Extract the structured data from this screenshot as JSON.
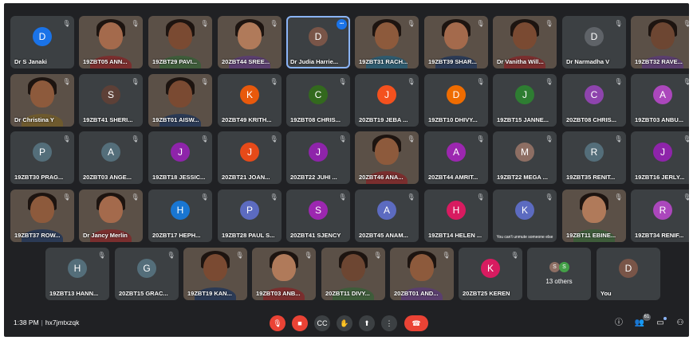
{
  "colors": {
    "background": "#202124",
    "tile": "#3c4043",
    "active_border": "#8ab4f8",
    "danger": "#ea4335"
  },
  "rows": [
    [
      {
        "name": "Dr S Janaki",
        "initial": "D",
        "color": "#1a73e8",
        "video": false
      },
      {
        "name": "19ZBT05 ANN...",
        "video": true
      },
      {
        "name": "19ZBT29 PAVI...",
        "video": true
      },
      {
        "name": "20ZBT44 SREE...",
        "video": true
      },
      {
        "name": "Dr Judia Harrie...",
        "initial": "D",
        "color": "#795548",
        "video": false,
        "active": true,
        "more": true
      },
      {
        "name": "19ZBT31 RACH...",
        "video": true
      },
      {
        "name": "19ZBT39 SHAR...",
        "video": true
      },
      {
        "name": "Dr Vanitha Will...",
        "video": true
      },
      {
        "name": "Dr Narmadha V",
        "initial": "D",
        "color": "#5f6368",
        "video": false
      },
      {
        "name": "19ZBT32 RAVE...",
        "video": true
      }
    ],
    [
      {
        "name": "Dr Christina Y",
        "video": true
      },
      {
        "name": "19ZBT41 SHERI...",
        "initial": "S",
        "color": "#5d4037",
        "video": false
      },
      {
        "name": "19ZBT01 AISW...",
        "video": true
      },
      {
        "name": "20ZBT49 KRITH...",
        "initial": "K",
        "color": "#e8590c",
        "video": false
      },
      {
        "name": "19ZBT08 CHRIS...",
        "initial": "C",
        "color": "#33691e",
        "video": false
      },
      {
        "name": "20ZBT19 JEBA ...",
        "initial": "J",
        "color": "#f4511e",
        "video": false
      },
      {
        "name": "19ZBT10 DHIVY...",
        "initial": "D",
        "color": "#ef6c00",
        "video": false
      },
      {
        "name": "19ZBT15 JANNE...",
        "initial": "J",
        "color": "#2e7d32",
        "video": false
      },
      {
        "name": "20ZBT08 CHRIS...",
        "initial": "C",
        "color": "#8e44ad",
        "video": false
      },
      {
        "name": "19ZBT03 ANBU...",
        "initial": "A",
        "color": "#ab47bc",
        "video": false
      }
    ],
    [
      {
        "name": "19ZBT30 PRAG...",
        "initial": "P",
        "color": "#546e7a",
        "video": false
      },
      {
        "name": "20ZBT03 ANGE...",
        "initial": "A",
        "color": "#546e7a",
        "video": false
      },
      {
        "name": "19ZBT18 JESSIC...",
        "initial": "J",
        "color": "#8e24aa",
        "video": false
      },
      {
        "name": "20ZBT21 JOAN...",
        "initial": "J",
        "color": "#e64a19",
        "video": false
      },
      {
        "name": "20ZBT22 JUHI ...",
        "initial": "J",
        "color": "#8e24aa",
        "video": false
      },
      {
        "name": "20ZBT46 ANA...",
        "video": true
      },
      {
        "name": "20ZBT44 AMRIT...",
        "initial": "A",
        "color": "#9c27b0",
        "video": false
      },
      {
        "name": "19ZBT22 MEGA ...",
        "initial": "M",
        "color": "#8d6e63",
        "video": false
      },
      {
        "name": "19ZBT35 RENIT...",
        "initial": "R",
        "color": "#546e7a",
        "video": false
      },
      {
        "name": "19ZBT16 JERLY...",
        "initial": "J",
        "color": "#8e24aa",
        "video": false
      }
    ],
    [
      {
        "name": "19ZBT37 ROW...",
        "video": true
      },
      {
        "name": "Dr Jancy Merlin",
        "video": true
      },
      {
        "name": "20ZBT17 HEPH...",
        "initial": "H",
        "color": "#1976d2",
        "video": false
      },
      {
        "name": "19ZBT28 PAUL S...",
        "initial": "P",
        "color": "#5c6bc0",
        "video": false
      },
      {
        "name": "20ZBT41 SJENCY",
        "initial": "S",
        "color": "#9c27b0",
        "video": false
      },
      {
        "name": "20ZBT45 ANAM...",
        "initial": "A",
        "color": "#5c6bc0",
        "video": false
      },
      {
        "name": "19ZBT14 HELEN ...",
        "initial": "H",
        "color": "#d81b60",
        "video": false
      },
      {
        "name": "You can't unmute someone else",
        "initial": "K",
        "color": "#5c6bc0",
        "video": false,
        "tooltip": true
      },
      {
        "name": "19ZBT11 EBINE...",
        "video": true
      },
      {
        "name": "19ZBT34 RENIF...",
        "initial": "R",
        "color": "#ab47bc",
        "video": false
      }
    ],
    [
      {
        "name": "19ZBT13 HANN...",
        "initial": "H",
        "color": "#546e7a",
        "video": false
      },
      {
        "name": "20ZBT15 GRAC...",
        "initial": "G",
        "color": "#546e7a",
        "video": false
      },
      {
        "name": "19ZBT19 KAN...",
        "video": true
      },
      {
        "name": "19ZBT03 ANB...",
        "video": true
      },
      {
        "name": "20ZBT11 DIVY...",
        "video": true
      },
      {
        "name": "20ZBT01 AND...",
        "video": true
      },
      {
        "name": "20ZBT25 KEREN",
        "initial": "K",
        "color": "#d81b60",
        "video": false
      },
      {
        "name": "13 others",
        "others": true
      },
      {
        "name": "You",
        "initial": "D",
        "color": "#795548",
        "video": false
      }
    ]
  ],
  "others": {
    "initials": [
      "S",
      "S"
    ],
    "colors": [
      "#8d6e63",
      "#43a047"
    ]
  },
  "meeting": {
    "time": "1:38 PM",
    "code": "hx7jmtxzqk"
  },
  "controls": {
    "mic": "mic-off",
    "camera": "camera-off",
    "captions": "CC",
    "raise_hand": "hand",
    "present": "present",
    "more": "⋮",
    "hangup": "end-call"
  },
  "right_controls": {
    "info": "i",
    "people_count": "61",
    "chat": "chat",
    "activities": "activities"
  }
}
